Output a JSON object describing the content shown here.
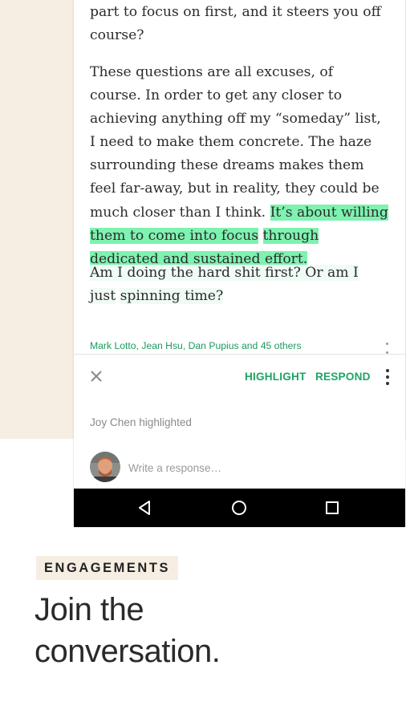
{
  "article": {
    "paragraph1": "part to focus on first, and it steers you off course?",
    "paragraph2_plain": "These questions are all excuses, of course. In order to get any closer to achieving anything off my “someday” list, I need to make them concrete. The haze surrounding these dreams makes them feel far-away, but in re­ality, they could be much closer than I think.",
    "paragraph2_highlight_line1": "It’s about willing them to come into focus",
    "paragraph2_highlight_line2": "through dedicated and sustained effort.",
    "paragraph3_line1": "Am I doing the hard shit first? Or am I just",
    "paragraph3_line2": "spinning time?"
  },
  "likers": "Mark Lotto, Jean Hsu, Dan Pupius and 45 others",
  "toolbar": {
    "highlight_label": "HIGHLIGHT",
    "respond_label": "RESPOND"
  },
  "highlighted_by": "Joy Chen highlighted",
  "response": {
    "placeholder": "Write a response…"
  },
  "promo": {
    "tag": "ENGAGEMENTS",
    "headline_line1": "Join the",
    "headline_line2": "conversation."
  },
  "colors": {
    "accent_green": "#1fa463",
    "highlight_green": "#7ef2b0",
    "beige": "#f6eee2"
  },
  "icons": [
    "close-icon",
    "more-vertical-icon",
    "back-icon",
    "home-icon",
    "recents-icon",
    "avatar"
  ]
}
